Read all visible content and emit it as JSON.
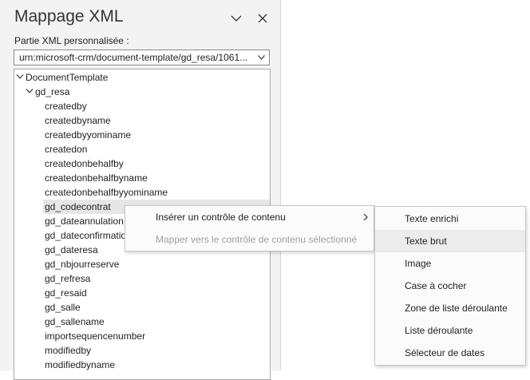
{
  "pane": {
    "title": "Mappage XML",
    "part_label": "Partie XML personnalisée :",
    "part_value": "urn:microsoft-crm/document-template/gd_resa/1061..."
  },
  "tree": {
    "root": "DocumentTemplate",
    "entity": "gd_resa",
    "fields": [
      "createdby",
      "createdbyname",
      "createdbyyominame",
      "createdon",
      "createdonbehalfby",
      "createdonbehalfbyname",
      "createdonbehalfbyyominame",
      "gd_codecontrat",
      "gd_dateannulation",
      "gd_dateconfirmation",
      "gd_dateresa",
      "gd_nbjourreserve",
      "gd_refresa",
      "gd_resaid",
      "gd_salle",
      "gd_sallename",
      "importsequencenumber",
      "modifiedby",
      "modifiedbyname"
    ],
    "selected_index": 7
  },
  "context_menu": {
    "insert": "Insérer un contrôle de contenu",
    "map": "Mapper vers le contrôle de contenu sélectionné"
  },
  "submenu": {
    "items": [
      "Texte enrichi",
      "Texte brut",
      "Image",
      "Case à cocher",
      "Zone de liste déroulante",
      "Liste déroulante",
      "Sélecteur de dates"
    ],
    "hover_index": 1
  },
  "icons": [
    "chevron-down-icon",
    "close-icon",
    "dropdown-arrow-icon",
    "expand-icon",
    "submenu-arrow-icon"
  ]
}
